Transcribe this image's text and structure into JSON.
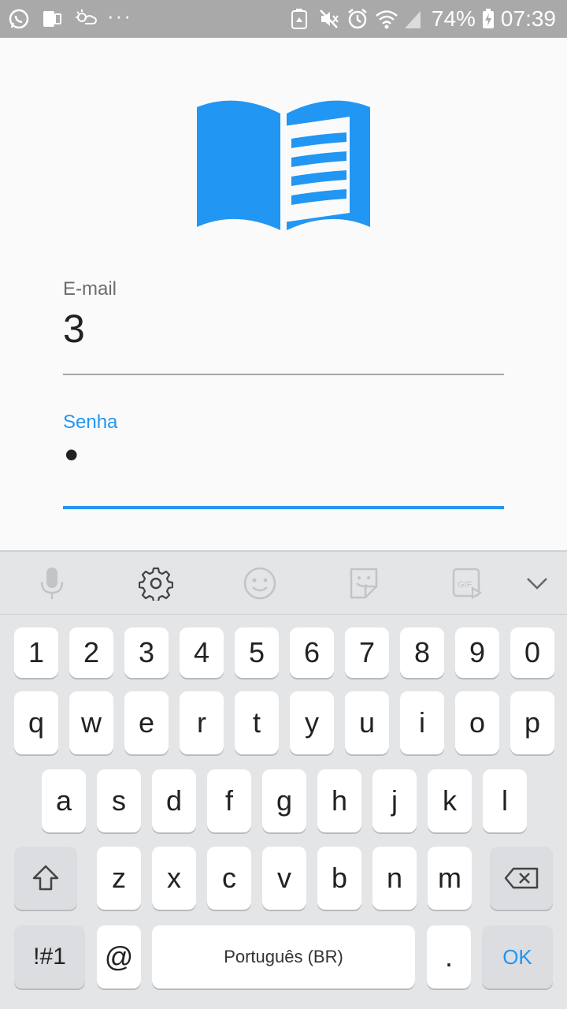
{
  "status_bar": {
    "battery_percent": "74%",
    "time": "07:39",
    "overflow": "···"
  },
  "app": {
    "email_label": "E-mail",
    "email_value": "3",
    "password_label": "Senha",
    "password_value": "•",
    "accent_color": "#2196f3"
  },
  "keyboard": {
    "toolbar_icons": [
      "microphone-icon",
      "gear-icon",
      "emoji-icon",
      "sticker-icon",
      "gif-icon",
      "chevron-down-icon"
    ],
    "row_numbers": [
      "1",
      "2",
      "3",
      "4",
      "5",
      "6",
      "7",
      "8",
      "9",
      "0"
    ],
    "row_q": [
      "q",
      "w",
      "e",
      "r",
      "t",
      "y",
      "u",
      "i",
      "o",
      "p"
    ],
    "row_a": [
      "a",
      "s",
      "d",
      "f",
      "g",
      "h",
      "j",
      "k",
      "l"
    ],
    "row_z": [
      "z",
      "x",
      "c",
      "v",
      "b",
      "n",
      "m"
    ],
    "symbols_key": "!#1",
    "at_key": "@",
    "space_label": "Português (BR)",
    "period_key": ".",
    "ok_key": "OK"
  }
}
